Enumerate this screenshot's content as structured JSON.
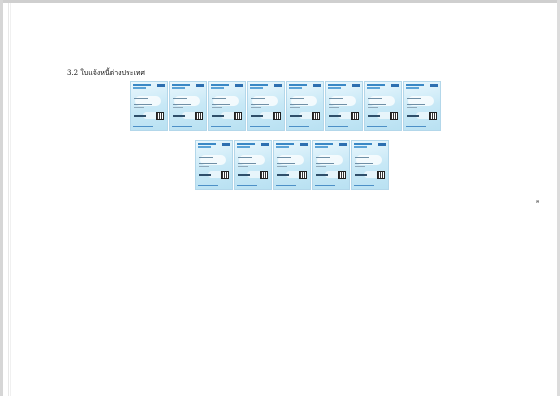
{
  "document": {
    "heading": "3.2 ใบแจ้งหนี้ต่างประเทศ",
    "stray_mark": "ค",
    "card_rows": [
      {
        "count": 8
      },
      {
        "count": 5
      }
    ]
  }
}
